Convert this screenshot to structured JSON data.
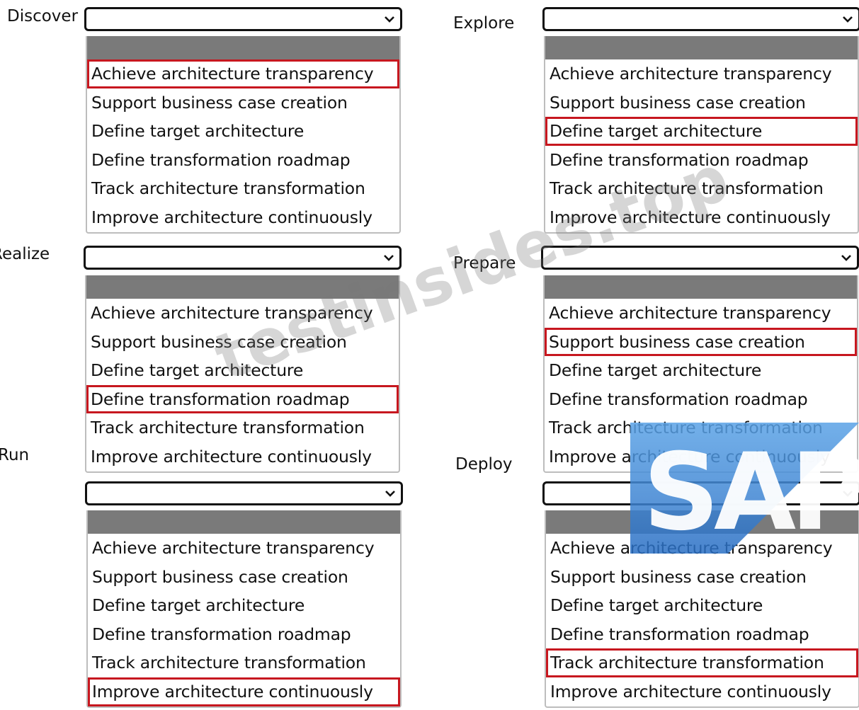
{
  "options": [
    "Achieve architecture transparency",
    "Support business case creation",
    "Define target architecture",
    "Define transformation roadmap",
    "Track architecture transformation",
    "Improve architecture continuously"
  ],
  "phases": [
    {
      "id": "discover",
      "label": "Discover",
      "selected": "",
      "highlighted_index": 0
    },
    {
      "id": "explore",
      "label": "Explore",
      "selected": "",
      "highlighted_index": 2
    },
    {
      "id": "realize",
      "label": "Realize",
      "selected": "",
      "highlighted_index": 3
    },
    {
      "id": "prepare",
      "label": "Prepare",
      "selected": "",
      "highlighted_index": 1
    },
    {
      "id": "run",
      "label": "Run",
      "selected": "",
      "highlighted_index": 5
    },
    {
      "id": "deploy",
      "label": "Deploy",
      "selected": "",
      "highlighted_index": 4
    }
  ],
  "watermark": {
    "text": "testinsides.top"
  },
  "logo": {
    "text": "SAP",
    "color": "#3d87d6"
  },
  "colors": {
    "highlight": "#c7171f",
    "blank_option": "#7a7a7a"
  }
}
